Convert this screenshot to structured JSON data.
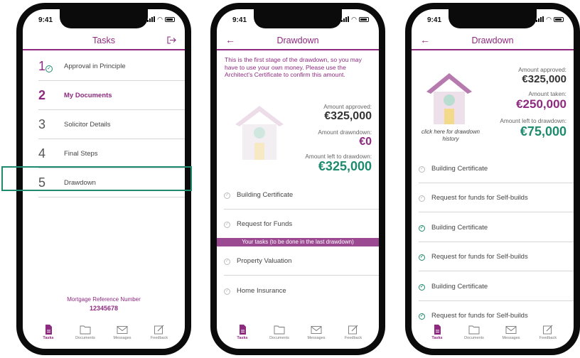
{
  "status": {
    "time": "9:41"
  },
  "colors": {
    "brand": "#8e2a80",
    "accent_green": "#1e8a6e"
  },
  "tabbar": [
    {
      "label": "Tasks",
      "icon": "document-filled-icon"
    },
    {
      "label": "Documents",
      "icon": "folder-icon"
    },
    {
      "label": "Messages",
      "icon": "mail-icon"
    },
    {
      "label": "Feedback",
      "icon": "edit-icon"
    }
  ],
  "screen1": {
    "title": "Tasks",
    "tasks": [
      {
        "num": "1",
        "label": "Approval in Principle"
      },
      {
        "num": "2",
        "label": "My Documents"
      },
      {
        "num": "3",
        "label": "Solicitor Details"
      },
      {
        "num": "4",
        "label": "Final Steps"
      },
      {
        "num": "5",
        "label": "Drawdown"
      }
    ],
    "ref_label": "Mortgage Reference Number",
    "ref_value": "12345678"
  },
  "screen2": {
    "title": "Drawdown",
    "intro": "This is the first stage of the drawdown, so you may have to use your own money. Please use the Architect's Certificate to confirm this amount.",
    "amounts": [
      {
        "label": "Amount approved:",
        "value": "€325,000"
      },
      {
        "label": "Amount drawndown:",
        "value": "€0"
      },
      {
        "label": "Amount left to drawdown:",
        "value": "€325,000"
      }
    ],
    "items_top": [
      "Building Certificate",
      "Request for Funds"
    ],
    "banner": "Your tasks (to be done in the last drawdown)",
    "items_bottom": [
      "Property Valuation",
      "Home Insurance"
    ]
  },
  "screen3": {
    "title": "Drawdown",
    "amounts": [
      {
        "label": "Amount approved:",
        "value": "€325,000"
      },
      {
        "label": "Amount taken:",
        "value": "€250,000"
      },
      {
        "label": "Amount left to drawdown:",
        "value": "€75,000"
      }
    ],
    "history_link": "click here for drawdown history",
    "items": [
      {
        "label": "Building Certificate",
        "done": false
      },
      {
        "label": "Request for funds for Self-builds",
        "done": false
      },
      {
        "label": "Building Certificate",
        "done": true
      },
      {
        "label": "Request for funds for Self-builds",
        "done": true
      },
      {
        "label": "Building Certificate",
        "done": true
      },
      {
        "label": "Request for funds for Self-builds",
        "done": true
      }
    ]
  }
}
